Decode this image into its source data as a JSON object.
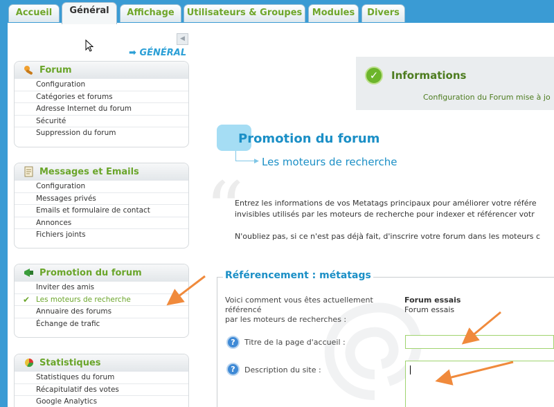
{
  "tabs": [
    {
      "label": "Accueil",
      "active": false
    },
    {
      "label": "Général",
      "active": true
    },
    {
      "label": "Affichage",
      "active": false
    },
    {
      "label": "Utilisateurs & Groupes",
      "active": false
    },
    {
      "label": "Modules",
      "active": false
    },
    {
      "label": "Divers",
      "active": false
    }
  ],
  "sidebar": {
    "heading": "GÉNÉRAL",
    "sections": [
      {
        "title": "Forum",
        "icon": "wrench-icon",
        "items": [
          "Configuration",
          "Catégories et forums",
          "Adresse Internet du forum",
          "Sécurité",
          "Suppression du forum"
        ]
      },
      {
        "title": "Messages et Emails",
        "icon": "document-icon",
        "items": [
          "Configuration",
          "Messages privés",
          "Emails et formulaire de contact",
          "Annonces",
          "Fichiers joints"
        ]
      },
      {
        "title": "Promotion du forum",
        "icon": "megaphone-icon",
        "items": [
          "Inviter des amis",
          "Les moteurs de recherche",
          "Annuaire des forums",
          "Échange de trafic"
        ],
        "current_index": 1
      },
      {
        "title": "Statistiques",
        "icon": "pie-chart-icon",
        "items": [
          "Statistiques du forum",
          "Récapitulatif des votes",
          "Google Analytics"
        ]
      }
    ]
  },
  "info": {
    "title": "Informations",
    "text": "Configuration du Forum mise à jo"
  },
  "main": {
    "title": "Promotion du forum",
    "subtitle": "Les moteurs de recherche",
    "para1_line1": "Entrez les informations de vos Metatags principaux pour améliorer votre référe",
    "para1_line2": "invisibles utilisés par les moteurs de recherche pour indexer et référencer votr",
    "para2": "N'oubliez pas, si ce n'est pas déjà fait, d'inscrire votre forum dans les moteurs c"
  },
  "fieldset": {
    "legend": "Référencement : métatags",
    "ref_label_l1": "Voici comment vous êtes actuellement",
    "ref_label_l2": "référencé",
    "ref_label_l3": "par les moteurs de recherches :",
    "ref_value_bold": "Forum essais",
    "ref_value": "Forum essais",
    "title_label": "Titre de la page d'accueil :",
    "title_value": "",
    "desc_label": "Description du site :",
    "desc_value": ""
  },
  "colors": {
    "accent_green": "#6aa52a",
    "accent_blue": "#1b8fc6",
    "background_blue": "#3a9bd4",
    "annotation_orange": "#f08a3c"
  }
}
